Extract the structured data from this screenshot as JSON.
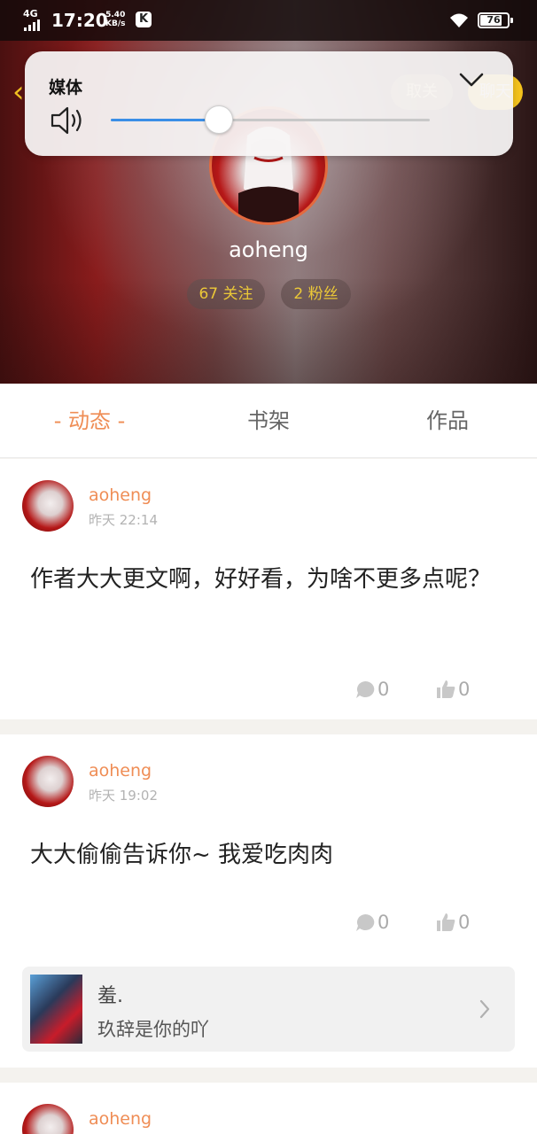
{
  "status_bar": {
    "network": "4G",
    "time": "17:20",
    "speed_value": "5.40",
    "speed_unit": "KB/s",
    "app_badge": "K",
    "battery": "76"
  },
  "header": {
    "follow_button": "取关",
    "chat_button": "聊天",
    "username": "aoheng",
    "following": "67 关注",
    "fans": "2 粉丝"
  },
  "volume_panel": {
    "title": "媒体",
    "level_fraction": 0.34
  },
  "tabs": [
    {
      "label": "- 动态 -",
      "active": true
    },
    {
      "label": "书架",
      "active": false
    },
    {
      "label": "作品",
      "active": false
    }
  ],
  "posts": [
    {
      "author": "aoheng",
      "time": "昨天 22:14",
      "content": "作者大大更文啊，好好看，为啥不更多点呢？",
      "comments": "0",
      "likes": "0"
    },
    {
      "author": "aoheng",
      "time": "昨天 19:02",
      "content": "大大偷偷告诉你~ 我爱吃肉肉",
      "comments": "0",
      "likes": "0",
      "quote": {
        "user": "羞.",
        "text": "玖辞是你的吖"
      }
    },
    {
      "author": "aoheng"
    }
  ],
  "colors": {
    "accent": "#ef8d55",
    "yellow": "#f4c21c",
    "slider": "#3a8ee6"
  }
}
